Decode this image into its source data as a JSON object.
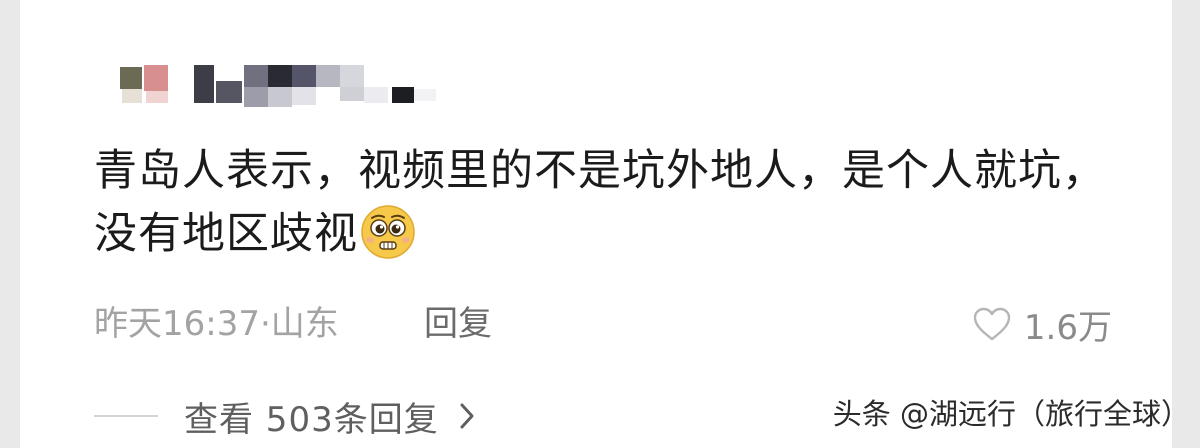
{
  "comment": {
    "line1": "青岛人表示，视频里的不是坑外地人，是个人就坑，",
    "line2": "没有地区歧视",
    "emoji": "pleading-face-emoji",
    "timestamp": "昨天16:37·山东",
    "reply_label": "回复",
    "likes": "1.6万",
    "view_replies": "查看 503条回复"
  },
  "watermark": "头条 @湖远行（旅行全球）",
  "icons": {
    "like": "heart-icon",
    "expand": "chevron-right-icon"
  },
  "colors": {
    "text": "#1b1b1b",
    "meta": "#a3a3a3",
    "reply": "#6b6b6b",
    "emoji": "#f6c94a"
  }
}
